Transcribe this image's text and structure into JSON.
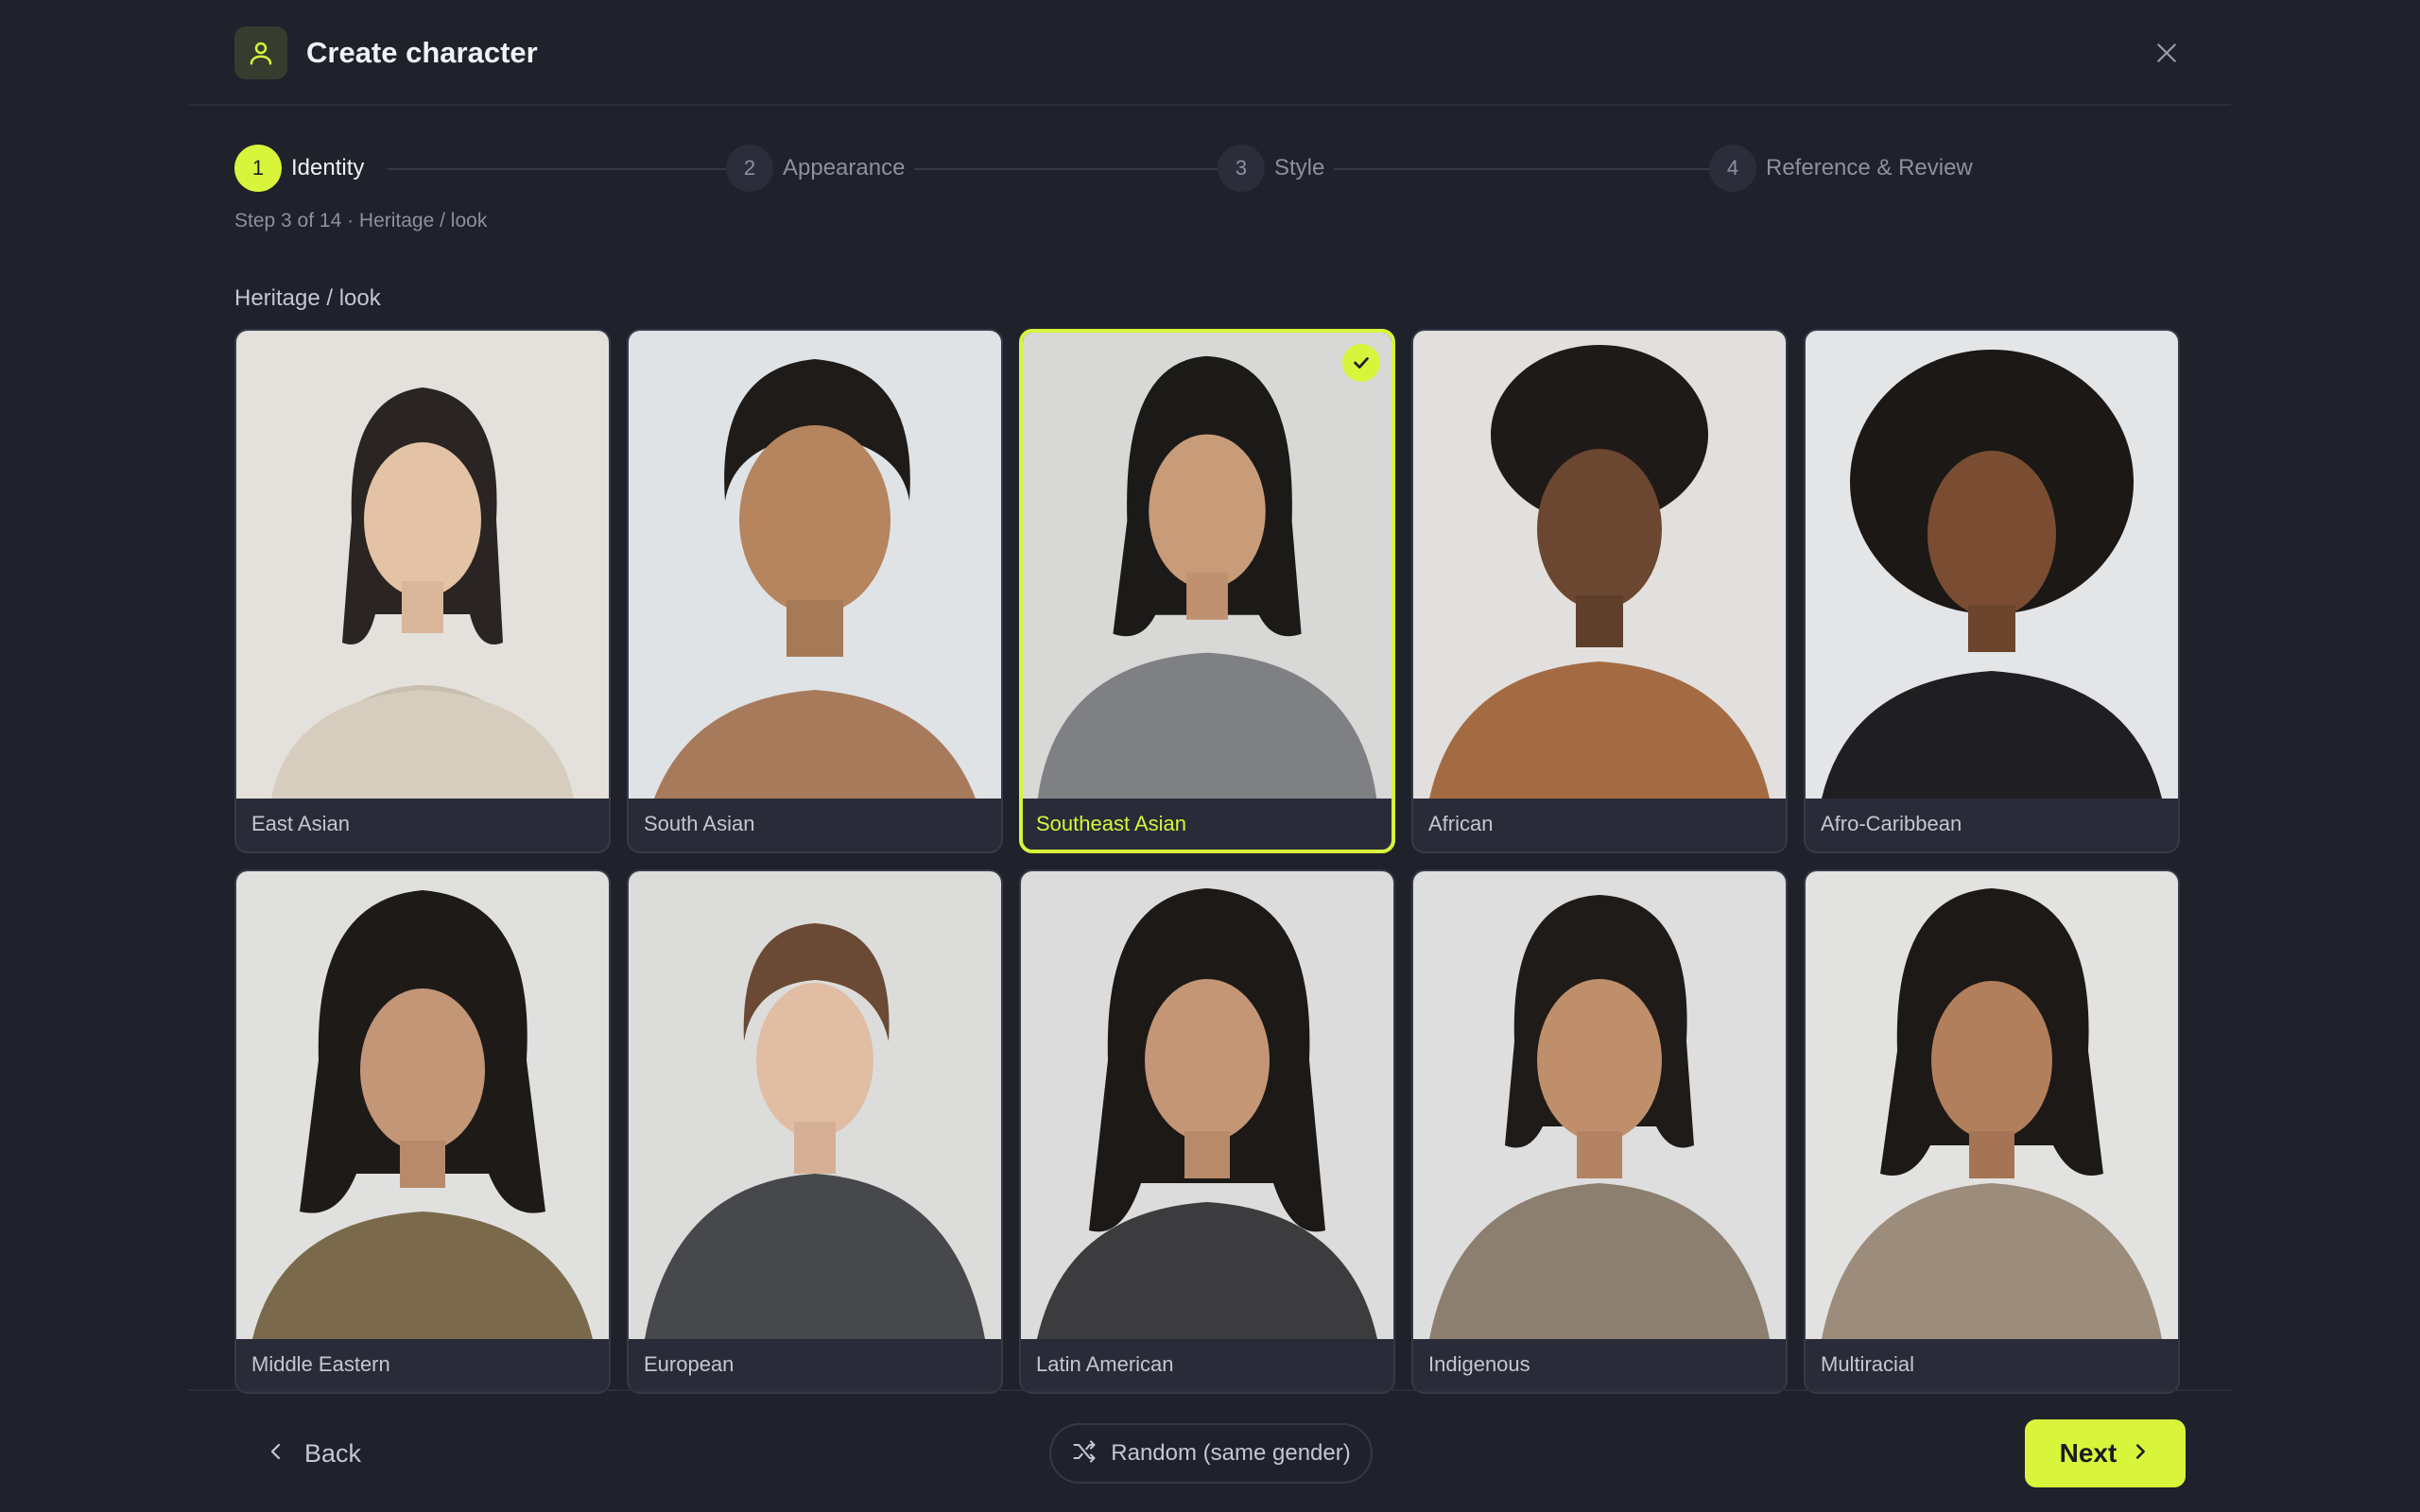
{
  "header": {
    "title": "Create character",
    "app_icon": "person-icon",
    "close_icon": "close-icon"
  },
  "stepper": {
    "steps": [
      {
        "number": "1",
        "label": "Identity",
        "active": true
      },
      {
        "number": "2",
        "label": "Appearance",
        "active": false
      },
      {
        "number": "3",
        "label": "Style",
        "active": false
      },
      {
        "number": "4",
        "label": "Reference & Review",
        "active": false
      }
    ],
    "meta": "Step 3 of 14 · Heritage / look"
  },
  "section": {
    "title": "Heritage / look"
  },
  "options": [
    {
      "label": "East Asian",
      "selected": false
    },
    {
      "label": "South Asian",
      "selected": false
    },
    {
      "label": "Southeast Asian",
      "selected": true
    },
    {
      "label": "African",
      "selected": false
    },
    {
      "label": "Afro-Caribbean",
      "selected": false
    },
    {
      "label": "Middle Eastern",
      "selected": false
    },
    {
      "label": "European",
      "selected": false
    },
    {
      "label": "Latin American",
      "selected": false
    },
    {
      "label": "Indigenous",
      "selected": false
    },
    {
      "label": "Multiracial",
      "selected": false
    }
  ],
  "footer": {
    "back_label": "Back",
    "random_label": "Random (same gender)",
    "next_label": "Next"
  },
  "colors": {
    "accent": "#d8f53c",
    "background": "#1f212b",
    "card": "#292c38"
  }
}
